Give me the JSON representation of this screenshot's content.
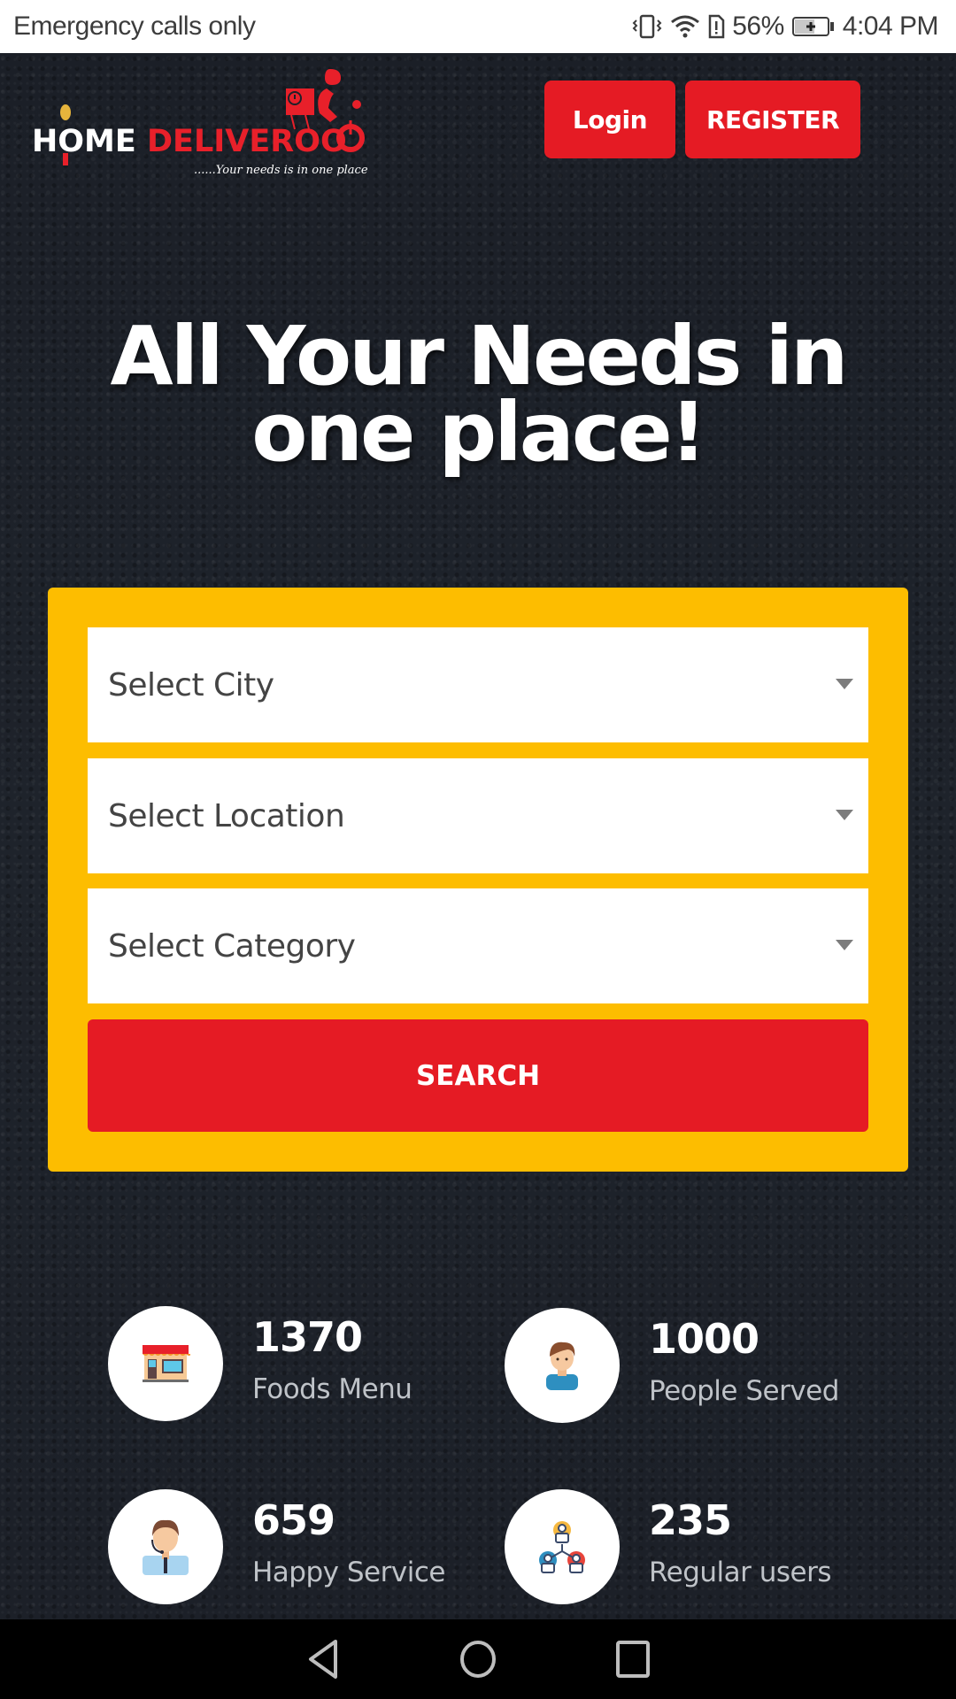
{
  "status_bar": {
    "carrier": "Emergency calls only",
    "battery_percent": "56%",
    "time": "4:04 PM",
    "icons": [
      "vibrate-icon",
      "wifi-icon",
      "sim-alert-icon",
      "battery-charging-icon"
    ]
  },
  "header": {
    "logo": {
      "word1": "HOME",
      "word2": "DELIVEROO",
      "tagline": "......Your needs is in one place"
    },
    "login_label": "Login",
    "register_label": "REGISTER"
  },
  "hero": {
    "title_line1": "All Your Needs in",
    "title_line2": "one place!"
  },
  "search": {
    "city_placeholder": "Select City",
    "location_placeholder": "Select Location",
    "category_placeholder": "Select Category",
    "search_label": "SEARCH"
  },
  "stats": [
    {
      "icon": "store-icon",
      "value": "1370",
      "label": "Foods Menu"
    },
    {
      "icon": "person-icon",
      "value": "1000",
      "label": "People Served"
    },
    {
      "icon": "support-agent-icon",
      "value": "659",
      "label": "Happy Service"
    },
    {
      "icon": "user-network-icon",
      "value": "235",
      "label": "Regular users"
    }
  ],
  "colors": {
    "brand_red": "#e51b24",
    "panel_yellow": "#fdbd00",
    "background_dark": "#1d2129"
  },
  "nav_bar": {
    "buttons": [
      "back",
      "home",
      "recents"
    ]
  }
}
